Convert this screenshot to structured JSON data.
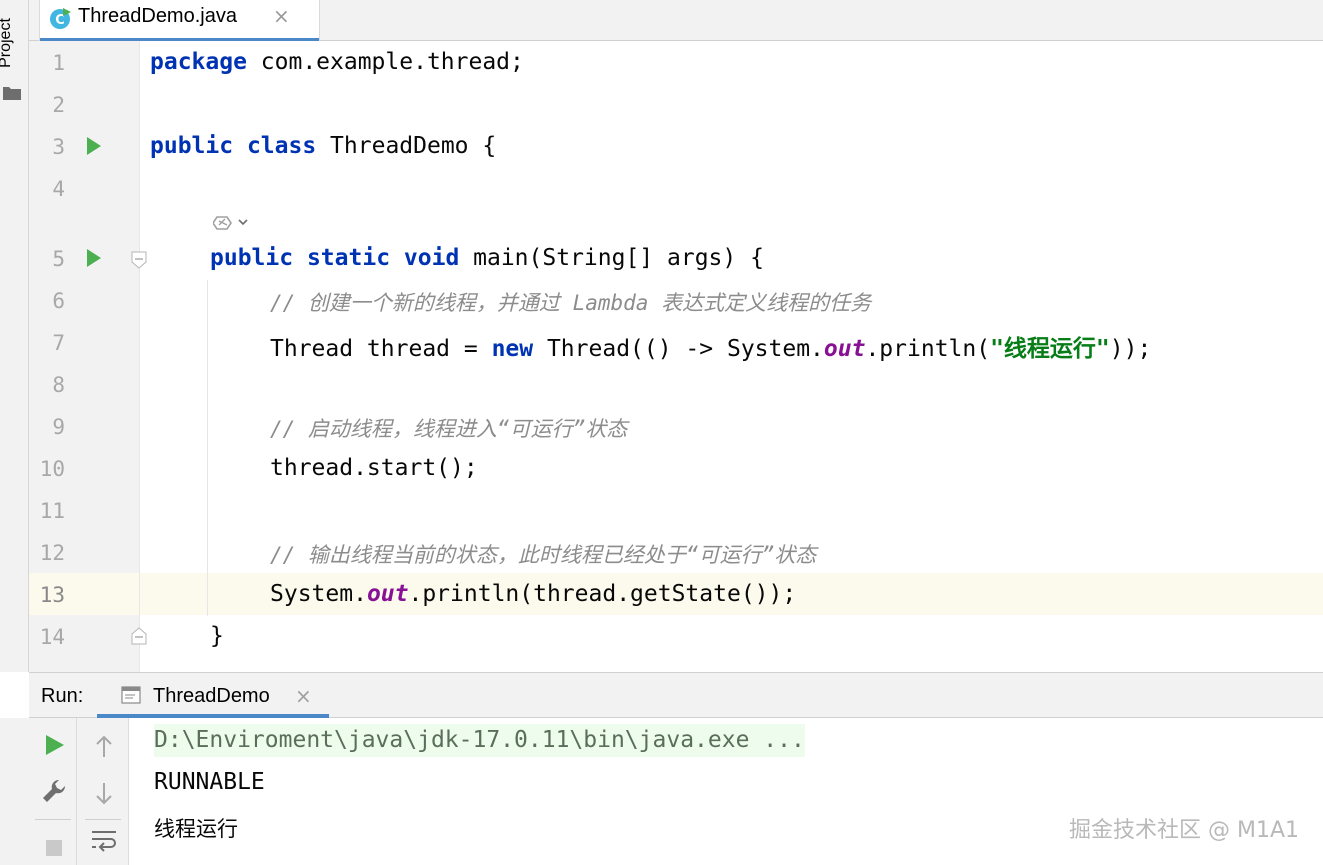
{
  "window": {
    "side_panel_label": "Project"
  },
  "editor_tab": {
    "label": "ThreadDemo.java",
    "close": "×"
  },
  "editor": {
    "line_numbers": [
      "1",
      "2",
      "3",
      "4",
      "5",
      "6",
      "7",
      "8",
      "9",
      "10",
      "11",
      "12",
      "13",
      "14"
    ],
    "current_line": "13",
    "run_gutter_lines": [
      "3",
      "5"
    ],
    "code": {
      "l1_kw": "package",
      "l1_rest": " com.example.thread;",
      "l3_kw1": "public",
      "l3_kw2": "class",
      "l3_rest": " ThreadDemo {",
      "l5_kw1": "public",
      "l5_kw2": "static",
      "l5_kw3": "void",
      "l5_rest": " main(String[] args) {",
      "l6_comment": "// 创建一个新的线程，并通过 Lambda 表达式定义线程的任务",
      "l7_a": "Thread thread = ",
      "l7_kw": "new",
      "l7_b": " Thread(() -> System.",
      "l7_field": "out",
      "l7_c": ".println(",
      "l7_str": "\"线程运行\"",
      "l7_d": "));",
      "l9_comment": "// 启动线程，线程进入“可运行”状态",
      "l10": "thread.start();",
      "l12_comment": "// 输出线程当前的状态，此时线程已经处于“可运行”状态",
      "l13_a": "System.",
      "l13_field": "out",
      "l13_b": ".println(thread.getState());",
      "l14": "}"
    }
  },
  "run_panel": {
    "title": "Run:",
    "tab_label": "ThreadDemo",
    "tab_close": "×",
    "output": [
      "D:\\Enviroment\\java\\jdk-17.0.11\\bin\\java.exe ...",
      "RUNNABLE",
      "线程运行"
    ]
  },
  "watermark": "掘金技术社区 @ M1A1",
  "colors": {
    "keyword": "#0033b3",
    "string": "#067d17",
    "comment": "#8c8c8c",
    "static_field": "#871094",
    "current_line_bg": "#fcfaed",
    "run_green": "#4caf50",
    "accent": "#4a88c7"
  }
}
